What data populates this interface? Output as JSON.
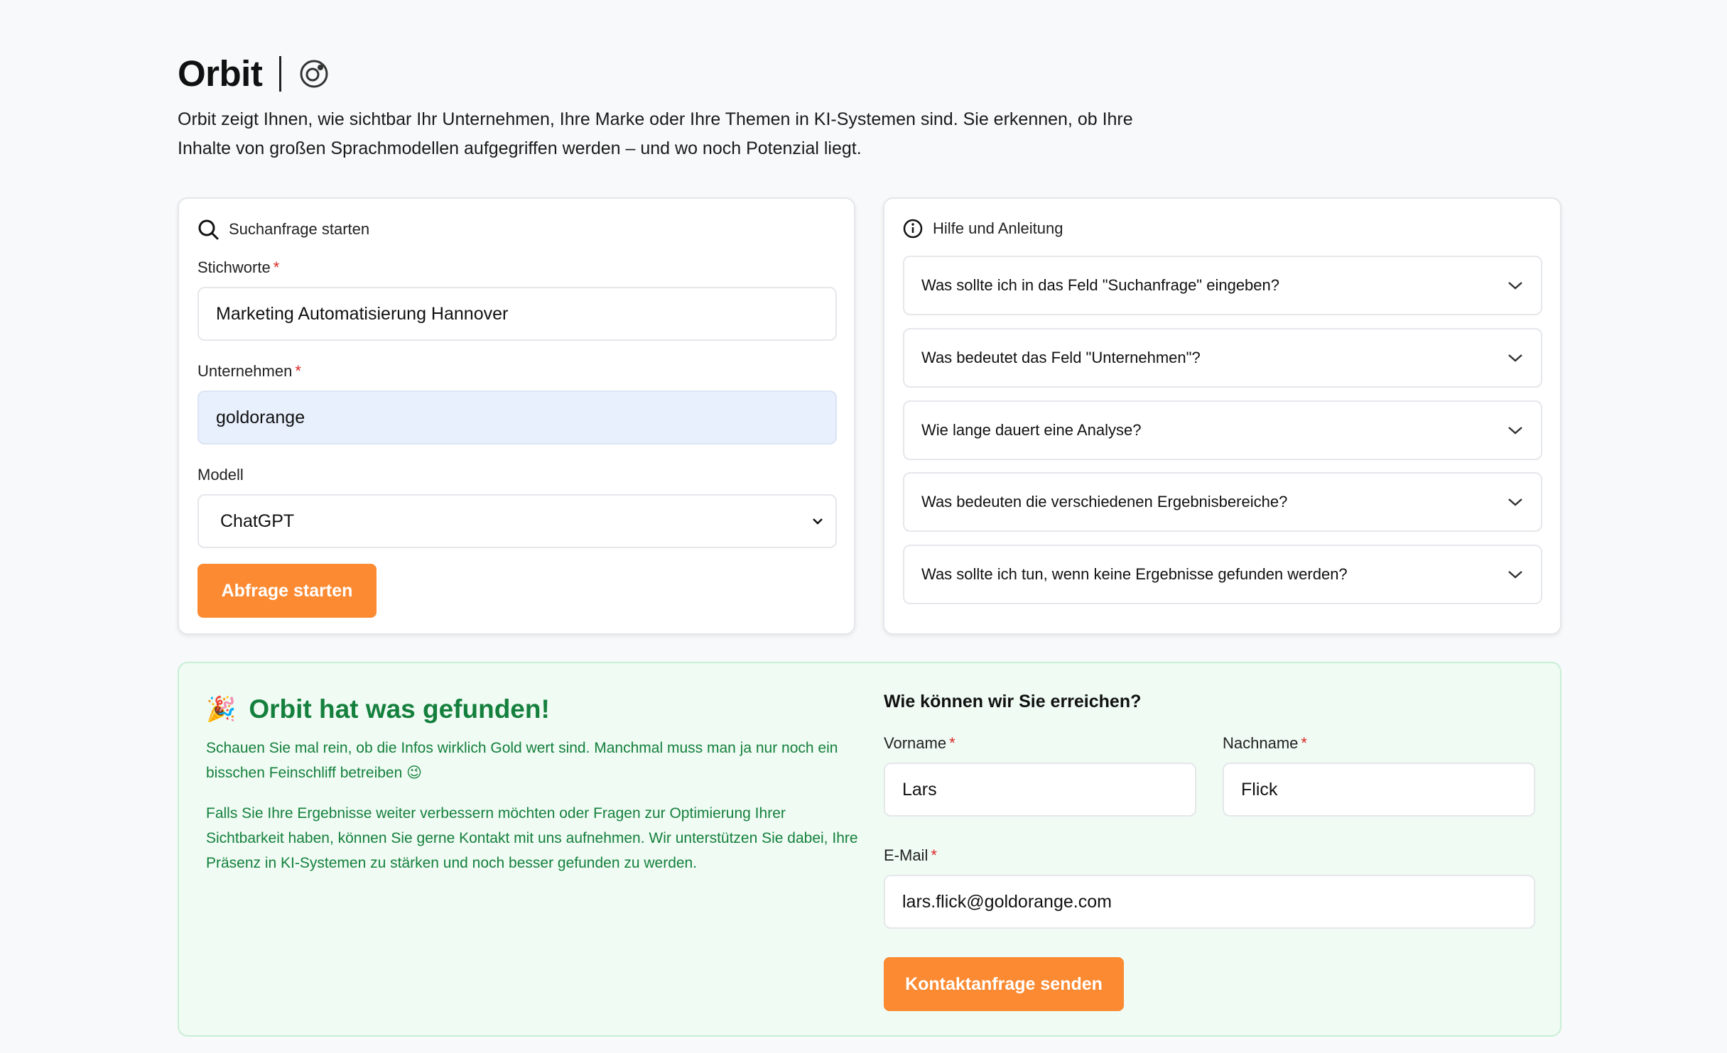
{
  "header": {
    "title": "Orbit",
    "intro": "Orbit zeigt Ihnen, wie sichtbar Ihr Unternehmen, Ihre Marke oder Ihre Themen in KI-Systemen sind. Sie erkennen, ob Ihre Inhalte von großen Sprachmodellen aufgegriffen werden – und wo noch Potenzial liegt."
  },
  "search": {
    "heading": "Suchanfrage starten",
    "keywords_label": "Stichworte",
    "keywords_value": "Marketing Automatisierung Hannover",
    "company_label": "Unternehmen",
    "company_value": "goldorange",
    "model_label": "Modell",
    "model_value": "ChatGPT",
    "submit_label": "Abfrage starten",
    "required_mark": "*"
  },
  "help": {
    "heading": "Hilfe und Anleitung",
    "faqs": [
      "Was sollte ich in das Feld \"Suchanfrage\" eingeben?",
      "Was bedeutet das Feld \"Unternehmen\"?",
      "Wie lange dauert eine Analyse?",
      "Was bedeuten die verschiedenen Ergebnisbereiche?",
      "Was sollte ich tun, wenn keine Ergebnisse gefunden werden?"
    ]
  },
  "result": {
    "emoji": "🎉",
    "title": "Orbit hat was gefunden!",
    "text1": "Schauen Sie mal rein, ob die Infos wirklich Gold wert sind. Manchmal muss man ja nur noch ein bisschen Feinschliff betreiben 😉",
    "text2": "Falls Sie Ihre Ergebnisse weiter verbessern möchten oder Fragen zur Optimierung Ihrer Sichtbarkeit haben, können Sie gerne Kontakt mit uns aufnehmen. Wir unterstützen Sie dabei, Ihre Präsenz in KI-Systemen zu stärken und noch besser gefunden zu werden."
  },
  "contact": {
    "title": "Wie können wir Sie erreichen?",
    "firstname_label": "Vorname",
    "firstname_value": "Lars",
    "lastname_label": "Nachname",
    "lastname_value": "Flick",
    "email_label": "E-Mail",
    "email_value": "lars.flick@goldorange.com",
    "submit_label": "Kontaktanfrage senden"
  },
  "colors": {
    "accent": "#fb8a32",
    "success_text": "#15803d",
    "success_bg": "#effbf3",
    "required": "#dc2626"
  }
}
